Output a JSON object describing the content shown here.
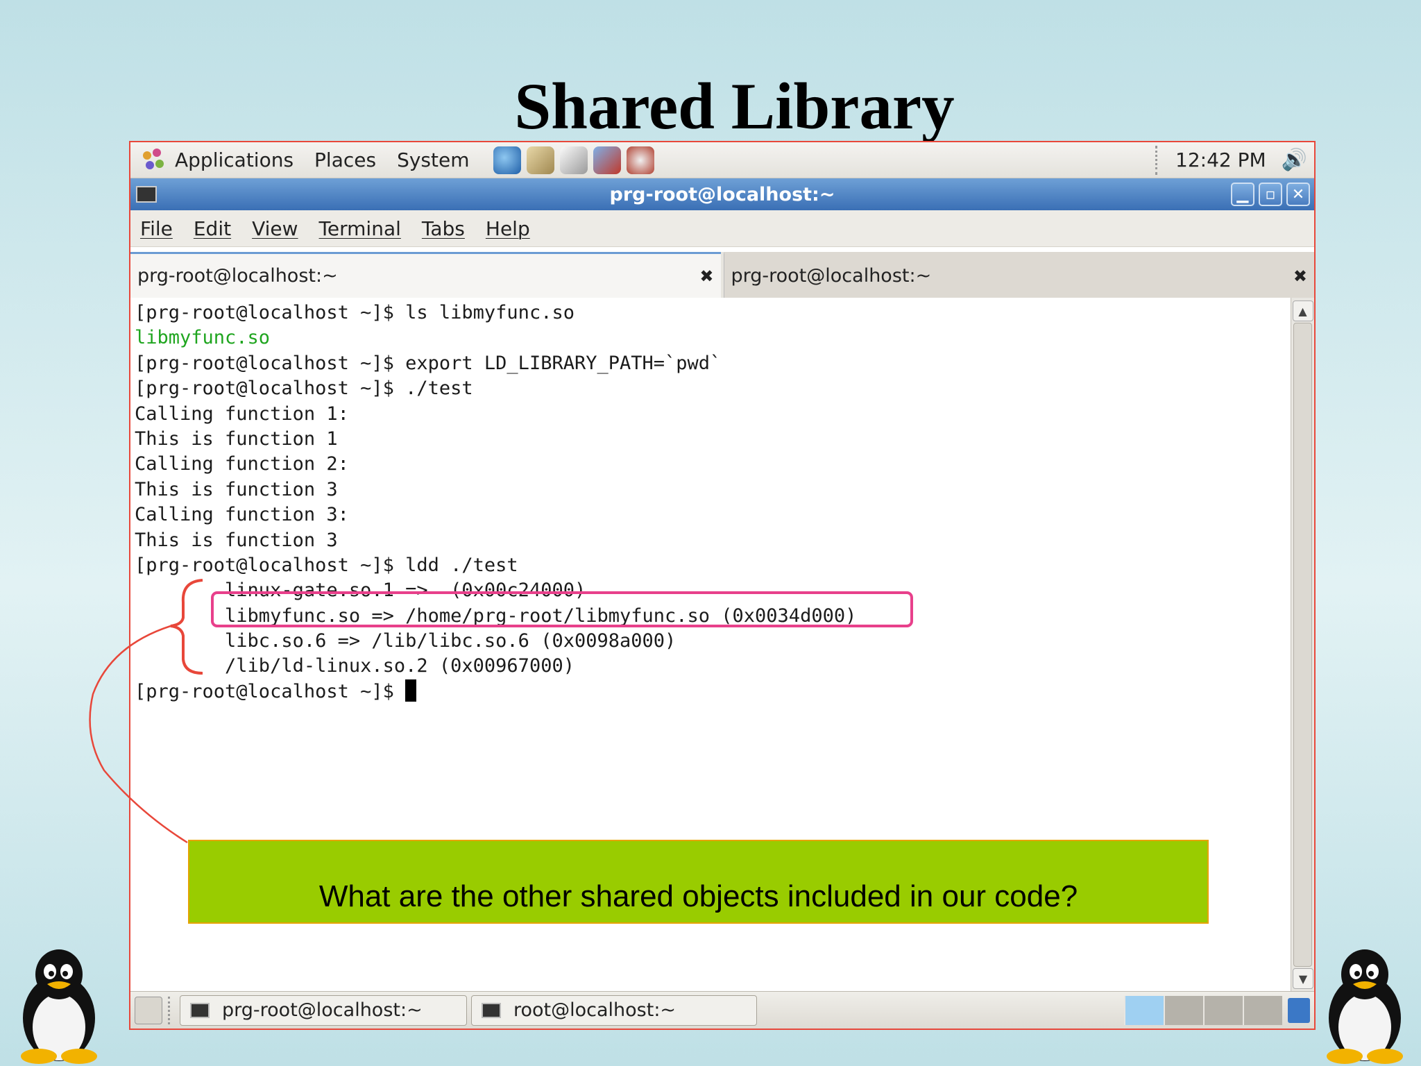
{
  "slide": {
    "title": "Shared Library"
  },
  "panel": {
    "menus": [
      "Applications",
      "Places",
      "System"
    ],
    "clock": "12:42 PM",
    "launcher_icons": [
      "web-browser-icon",
      "mail-icon",
      "text-editor-icon",
      "presentation-icon",
      "help-icon"
    ]
  },
  "window": {
    "title": "prg-root@localhost:~",
    "buttons": [
      "minimize",
      "maximize",
      "close"
    ]
  },
  "menubar": [
    "File",
    "Edit",
    "View",
    "Terminal",
    "Tabs",
    "Help"
  ],
  "tabs": [
    {
      "label": "prg-root@localhost:~",
      "active": true
    },
    {
      "label": "prg-root@localhost:~",
      "active": false
    }
  ],
  "terminal": {
    "lines": [
      "[prg-root@localhost ~]$ ls libmyfunc.so",
      "libmyfunc.so",
      "[prg-root@localhost ~]$ export LD_LIBRARY_PATH=`pwd`",
      "[prg-root@localhost ~]$ ./test",
      "Calling function 1:",
      "This is function 1",
      "Calling function 2:",
      "This is function 3",
      "Calling function 3:",
      "This is function 3",
      "[prg-root@localhost ~]$ ldd ./test",
      "        linux-gate.so.1 =>  (0x00c24000)",
      "        libmyfunc.so => /home/prg-root/libmyfunc.so (0x0034d000)",
      "        libc.so.6 => /lib/libc.so.6 (0x0098a000)",
      "        /lib/ld-linux.so.2 (0x00967000)",
      "[prg-root@localhost ~]$ "
    ]
  },
  "taskbar": {
    "tasks": [
      "prg-root@localhost:~",
      "root@localhost:~"
    ]
  },
  "callout": {
    "text": "What are the other shared objects included in our code?"
  },
  "colors": {
    "highlight": "#e8408b",
    "bracket": "#e8473a",
    "callout_bg": "#99cc00",
    "titlebar": "#3a6fb5"
  }
}
